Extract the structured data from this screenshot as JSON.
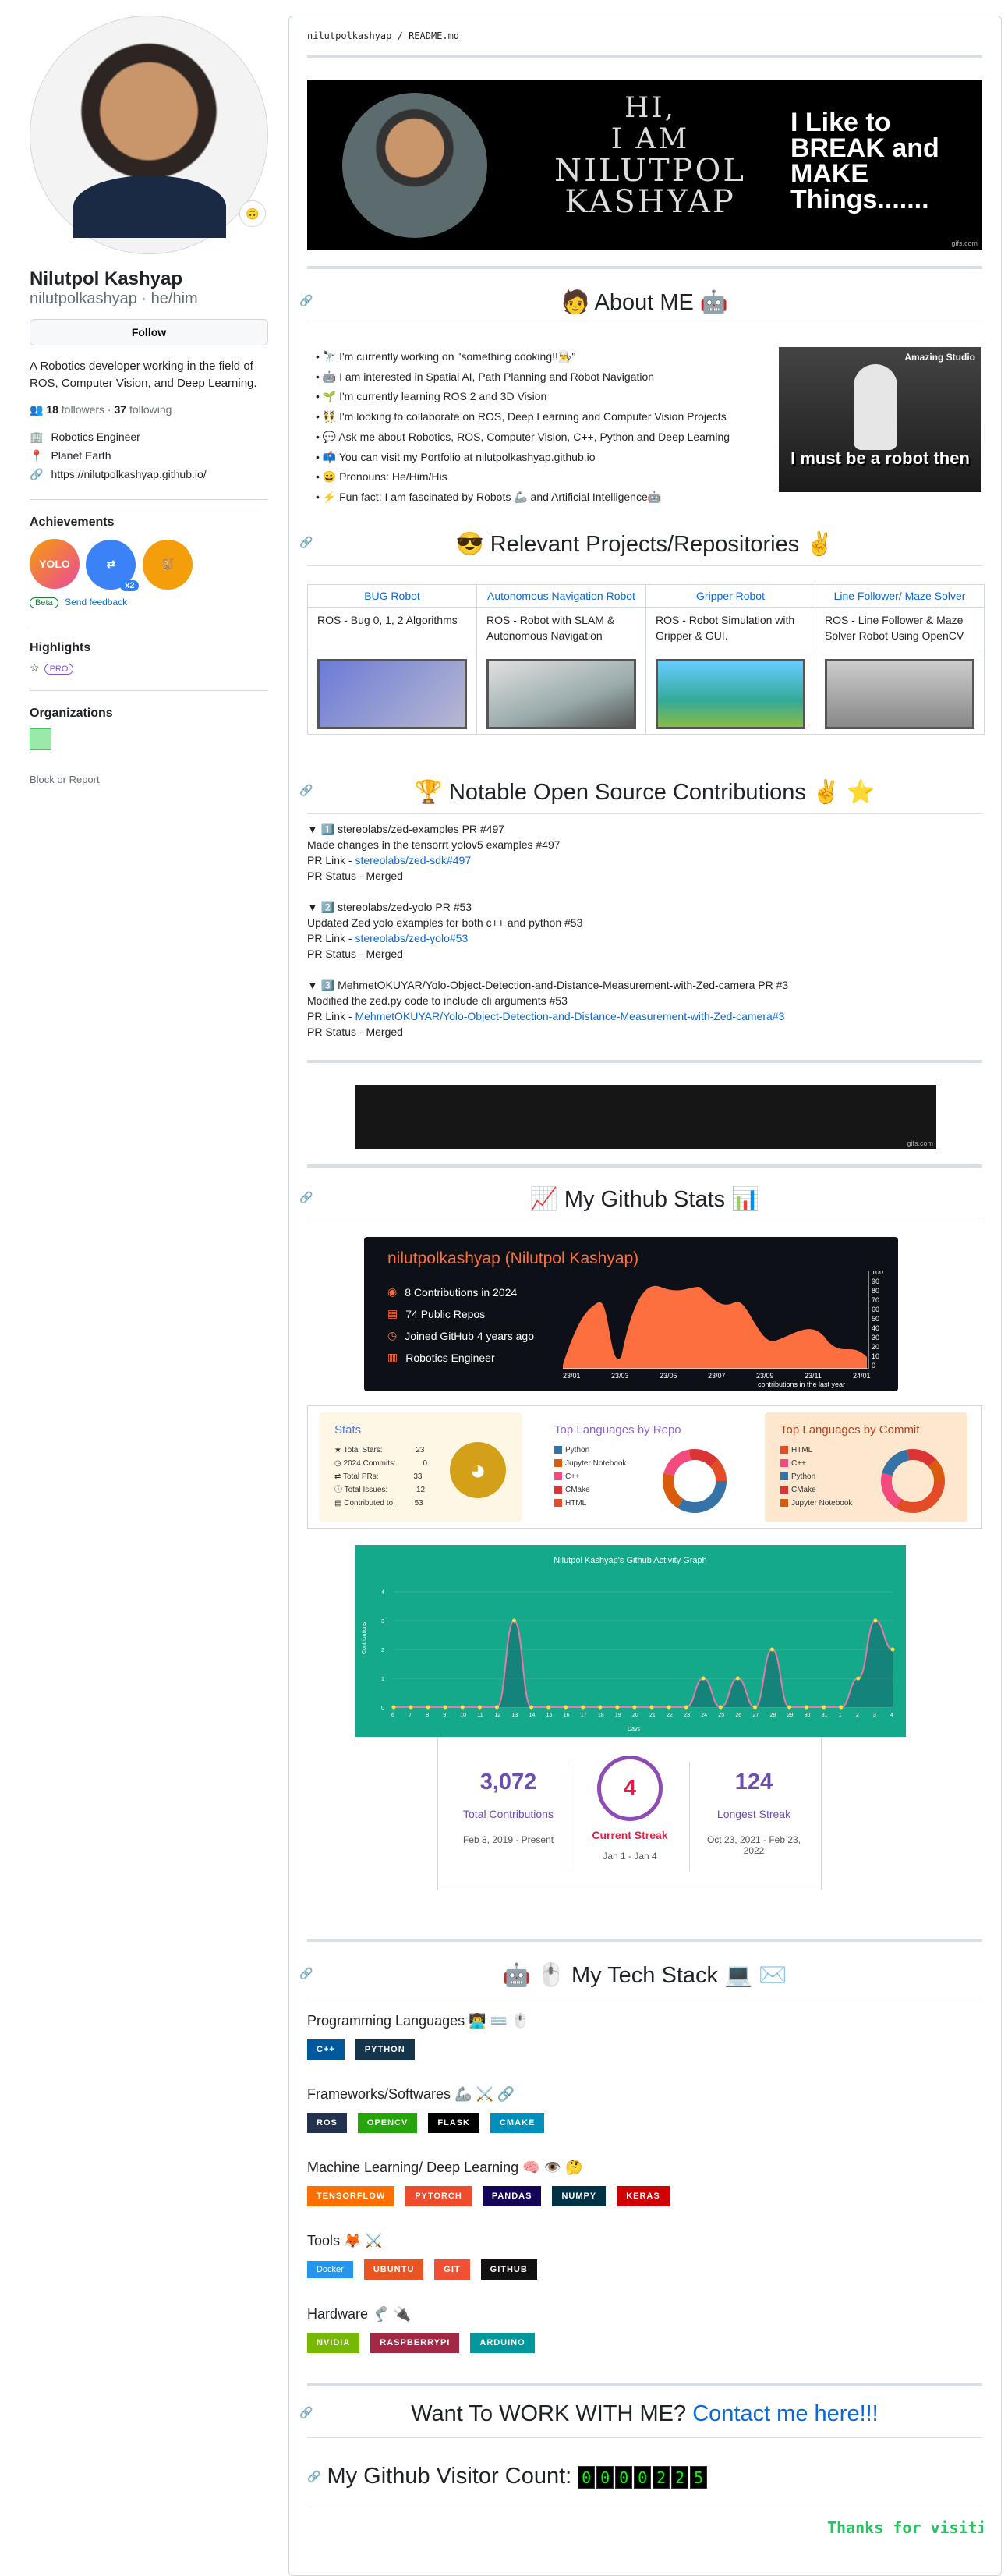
{
  "profile": {
    "name": "Nilutpol Kashyap",
    "login": "nilutpolkashyap · he/him",
    "follow_label": "Follow",
    "bio": "A Robotics developer working in the field of ROS, Computer Vision, and Deep Learning.",
    "followers": "18",
    "followers_label": "followers",
    "following": "37",
    "following_label": "following",
    "status_icon": "🙃",
    "role": "Robotics Engineer",
    "location": "Planet Earth",
    "website": "https://nilutpolkashyap.github.io/"
  },
  "achievements": {
    "title": "Achievements",
    "badge1": "YOLO",
    "badge2": "⇄",
    "badge3": "🐒",
    "badge2_count": "x2",
    "beta": "Beta",
    "feedback": "Send feedback"
  },
  "highlights": {
    "title": "Highlights",
    "pro": "PRO"
  },
  "organizations": {
    "title": "Organizations"
  },
  "block_report": "Block or Report",
  "readme": {
    "path_user": "nilutpolkashyap",
    "path_sep": " / ",
    "path_file": "README.md",
    "banner_hi": "HI,",
    "banner_iam": "I AM",
    "banner_name1": "NILUTPOL",
    "banner_name2": "KASHYAP",
    "banner_right": "I Like to BREAK and MAKE Things.......",
    "gif_tag": "gifs.com",
    "about_title": "🧑 About ME 🤖",
    "about_items": [
      "🔭 I'm currently working on \"something cooking!!👨‍🍳\"",
      "🤖 I am interested in Spatial AI, Path Planning and Robot Navigation",
      "🌱 I'm currently learning ROS 2 and 3D Vision",
      "👯 I'm looking to collaborate on ROS, Deep Learning and Computer Vision Projects",
      "💬 Ask me about Robotics, ROS, Computer Vision, C++, Python and Deep Learning",
      "📫 You can visit my Portfolio at nilutpolkashyap.github.io",
      "😄 Pronouns: He/Him/His",
      "⚡ Fun fact: I am fascinated by Robots 🦾 and Artificial Intelligence🤖"
    ],
    "robot_gif_caption": "Amazing Studio",
    "robot_gif_text": "I must be a robot then",
    "projects_title": "😎 Relevant Projects/Repositories ✌️",
    "projects": [
      {
        "name": "BUG Robot",
        "desc": "ROS - Bug 0, 1, 2 Algorithms"
      },
      {
        "name": "Autonomous Navigation Robot",
        "desc": "ROS - Robot with SLAM & Autonomous Navigation"
      },
      {
        "name": "Gripper Robot",
        "desc": "ROS - Robot Simulation with Gripper & GUI."
      },
      {
        "name": "Line Follower/ Maze Solver",
        "desc": "ROS - Line Follower & Maze Solver Robot Using OpenCV"
      }
    ],
    "contrib_title": "🏆 Notable Open Source Contributions ✌️ ⭐",
    "contributions": [
      {
        "summary": "▼ 1️⃣ stereolabs/zed-examples PR #497",
        "desc": "Made changes in the tensorrt yolov5 examples #497",
        "link_label": "PR Link - ",
        "link": "stereolabs/zed-sdk#497",
        "status": "PR Status - Merged"
      },
      {
        "summary": "▼ 2️⃣ stereolabs/zed-yolo PR #53",
        "desc": "Updated Zed yolo examples for both c++ and python #53",
        "link_label": "PR Link - ",
        "link": "stereolabs/zed-yolo#53",
        "status": "PR Status - Merged"
      },
      {
        "summary": "▼ 3️⃣ MehmetOKUYAR/Yolo-Object-Detection-and-Distance-Measurement-with-Zed-camera PR #3",
        "desc": "Modified the zed.py code to include cli arguments #53",
        "link_label": "PR Link - ",
        "link": "MehmetOKUYAR/Yolo-Object-Detection-and-Distance-Measurement-with-Zed-camera#3",
        "status": "PR Status - Merged"
      }
    ],
    "stats_title": "📈 My Github Stats 📊",
    "stats_name": "nilutpolkashyap (Nilutpol Kashyap)",
    "stats_rows": [
      "8 Contributions in 2024",
      "74 Public Repos",
      "Joined GitHub 4 years ago",
      "Robotics Engineer"
    ],
    "stats_graph_label": "contributions in the last year",
    "stats_yticks": [
      "100",
      "90",
      "80",
      "70",
      "60",
      "50",
      "40",
      "30",
      "20",
      "10",
      "0"
    ],
    "stats_xticks": [
      "23/01",
      "23/03",
      "23/05",
      "23/07",
      "23/09",
      "23/11",
      "24/01"
    ],
    "card_stats": {
      "title": "Stats",
      "rows": [
        [
          "Total Stars:",
          "23"
        ],
        [
          "2024 Commits:",
          "0"
        ],
        [
          "Total PRs:",
          "33"
        ],
        [
          "Total Issues:",
          "12"
        ],
        [
          "Contributed to:",
          "53"
        ]
      ]
    },
    "card_lang_repo": {
      "title": "Top Languages by Repo",
      "items": [
        "Python",
        "Jupyter Notebook",
        "C++",
        "CMake",
        "HTML"
      ],
      "colors": [
        "#3572A5",
        "#DA5B0B",
        "#f34b7d",
        "#DA3434",
        "#e34c26"
      ]
    },
    "card_lang_commit": {
      "title": "Top Languages by Commit",
      "items": [
        "HTML",
        "C++",
        "Python",
        "CMake",
        "Jupyter Notebook"
      ],
      "colors": [
        "#e34c26",
        "#f34b7d",
        "#3572A5",
        "#DA3434",
        "#DA5B0B"
      ]
    },
    "activity_title": "Nilutpol Kashyap's Github Activity Graph",
    "activity_ylabel": "Contributions",
    "activity_xlabel": "Days",
    "activity_data": {
      "x": [
        "6",
        "7",
        "8",
        "9",
        "10",
        "11",
        "12",
        "13",
        "14",
        "15",
        "16",
        "17",
        "18",
        "19",
        "20",
        "21",
        "22",
        "23",
        "24",
        "25",
        "26",
        "27",
        "28",
        "29",
        "30",
        "31",
        "1",
        "2",
        "3",
        "4"
      ],
      "y": [
        0,
        0,
        0,
        0,
        0,
        0,
        0,
        3,
        0,
        0,
        0,
        0,
        0,
        0,
        0,
        0,
        0,
        0,
        1,
        0,
        1,
        0,
        2,
        0,
        0,
        0,
        0,
        1,
        3,
        2
      ],
      "ylim": [
        0,
        4
      ]
    },
    "streak": {
      "total": "3,072",
      "total_label": "Total Contributions",
      "total_range": "Feb 8, 2019 - Present",
      "current": "4",
      "current_label": "Current Streak",
      "current_range": "Jan 1 - Jan 4",
      "longest": "124",
      "longest_label": "Longest Streak",
      "longest_range": "Oct 23, 2021 - Feb 23, 2022"
    },
    "tech_title": "🤖 🖱️ My Tech Stack 💻 ✉️",
    "tech": {
      "lang_h": "Programming Languages 👨‍💻 ⌨️ 🖱️",
      "lang": [
        "C++",
        "PYTHON"
      ],
      "fw_h": "Frameworks/Softwares 🦾 ⚔️ 🔗",
      "fw": [
        "ROS",
        "OPENCV",
        "FLASK",
        "CMAKE"
      ],
      "ml_h": "Machine Learning/ Deep Learning 🧠 👁️ 🤔",
      "ml": [
        "TENSORFLOW",
        "PYTORCH",
        "PANDAS",
        "NUMPY",
        "KERAS"
      ],
      "tools_h": "Tools 🦊 ⚔️",
      "tools": [
        "Docker",
        "UBUNTU",
        "GIT",
        "GITHUB"
      ],
      "hw_h": "Hardware 🦿 🔌",
      "hw": [
        "NVIDIA",
        "RASPBERRYPI",
        "ARDUINO"
      ]
    },
    "work_text": "Want To WORK WITH ME? ",
    "work_link": "Contact me here!!!",
    "visitor_label": "My Github Visitor Count:",
    "visitor_digits": [
      "0",
      "0",
      "0",
      "0",
      "2",
      "2",
      "5"
    ],
    "thanks": "Thanks for visiting!"
  }
}
